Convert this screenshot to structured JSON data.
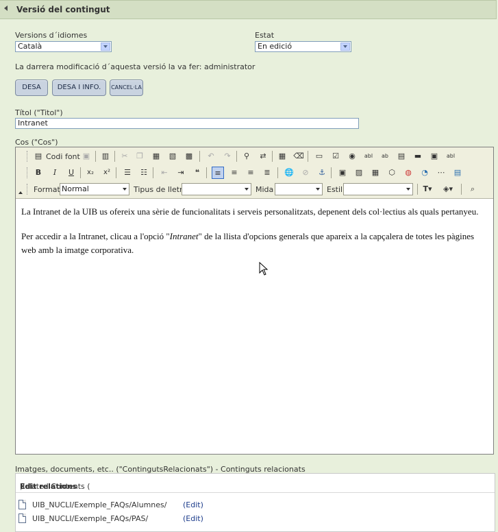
{
  "panel": {
    "title": "Versió del contingut"
  },
  "language": {
    "label": "Versions d´idiomes",
    "value": "Català"
  },
  "state": {
    "label": "Estat",
    "value": "En edició"
  },
  "last_modified": "La darrera modificació d´aquesta versió la va fer: administrator",
  "buttons": {
    "save": "DESA",
    "save_info": "DESA I INFO.",
    "cancel": "CANCEL·LA"
  },
  "title_field": {
    "label": "Títol (\"Titol\")",
    "value": "Intranet"
  },
  "body_field": {
    "label": "Cos (\"Cos\")"
  },
  "toolbar": {
    "source_label": "Codi font",
    "format_label": "Format",
    "format_value": "Normal",
    "font_label": "Tipus de lletra",
    "font_value": "",
    "size_label": "Mida",
    "size_value": "",
    "style_label": "Estil",
    "style_value": ""
  },
  "content": {
    "p1": "La Intranet de la UIB us ofereix una sèrie de funcionalitats i serveis personalitzats, depenent dels col·lectius als quals pertanyeu.",
    "p2_before": "Per accedir a la Intranet, clicau a l'opció \"",
    "p2_italic": "Intranet",
    "p2_after": "\" de la llista d'opcions generals que apareix a la capçalera de totes les pàgines web amb la imatge corporativa."
  },
  "related": {
    "label": "Imatges, documents, etc.. (\"ContingutsRelacionats\") - Continguts relacionats",
    "header_prefix": "Related Contents (",
    "edit_relations": "Edit relations",
    "header_suffix": ")",
    "items": [
      {
        "path": "UIB_NUCLI/Exemple_FAQs/Alumnes/",
        "action": "(Edit)"
      },
      {
        "path": "UIB_NUCLI/Exemple_FAQs/PAS/",
        "action": "(Edit)"
      }
    ]
  }
}
